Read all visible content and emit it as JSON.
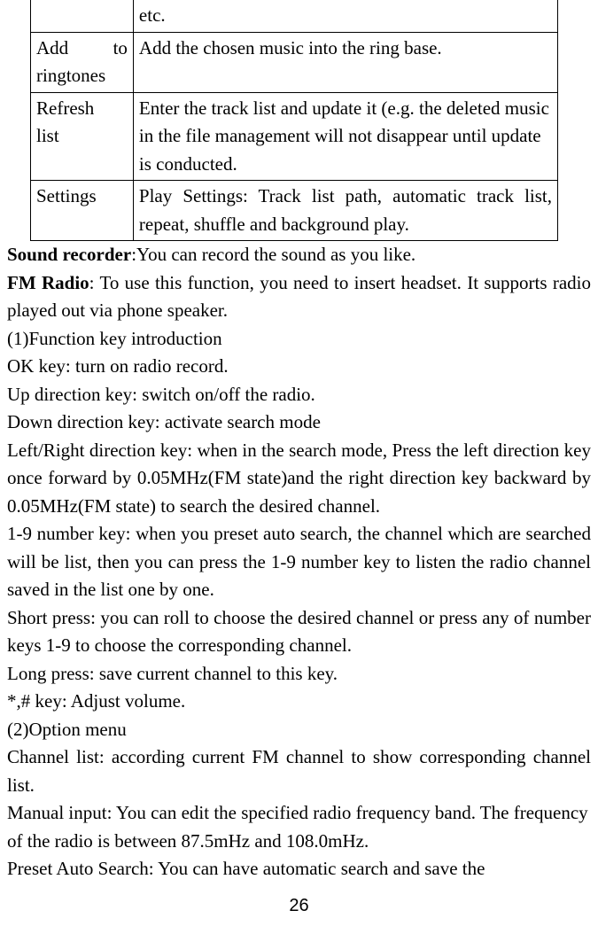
{
  "table": {
    "row0": {
      "col1": "",
      "col2": "etc."
    },
    "row1": {
      "col1_a": "Add",
      "col1_b": "to",
      "col1_line2": "ringtones",
      "col2": "Add the chosen music into the ring base."
    },
    "row2": {
      "col1_line1": "Refresh",
      "col1_line2": "list",
      "col2": "Enter the track list and update it (e.g. the deleted music in the file management will not disappear until update is conducted."
    },
    "row3": {
      "col1": "Settings",
      "col2": "Play Settings: Track list path, automatic track list, repeat, shuffle and background play."
    }
  },
  "paragraphs": {
    "p1_bold": "Sound recorder",
    "p1_rest": ":You can record the sound as you like.",
    "p2_bold": "FM Radio",
    "p2_rest": ": To use this function, you need to insert headset. It supports radio played out via phone speaker.",
    "p3": "(1)Function key introduction",
    "p4": "OK key: turn on radio record.",
    "p5": "Up direction key: switch on/off the radio.",
    "p6": "Down direction key: activate search mode",
    "p7": "Left/Right direction key: when in the search mode, Press the left direction key once forward by 0.05MHz(FM state)and the right direction key backward by 0.05MHz(FM state) to search the desired channel.",
    "p8": "1-9 number key: when you preset auto search, the channel which are searched will be list, then you can press the 1-9 number key to listen the radio channel saved in the list one by one.",
    "p9": "Short press: you can roll to choose the desired channel or press any of number keys 1-9 to choose the corresponding channel.",
    "p10": "Long press: save current channel to this key.",
    "p11": "*,# key: Adjust volume.",
    "p12": "(2)Option menu",
    "p13": "Channel list: according current FM channel to show corresponding channel list.",
    "p14": "Manual input: You can edit the specified radio frequency band. The frequency of the radio is between 87.5mHz and 108.0mHz.",
    "p15": "Preset Auto Search: You can have automatic search and save the"
  },
  "page_number": "26"
}
